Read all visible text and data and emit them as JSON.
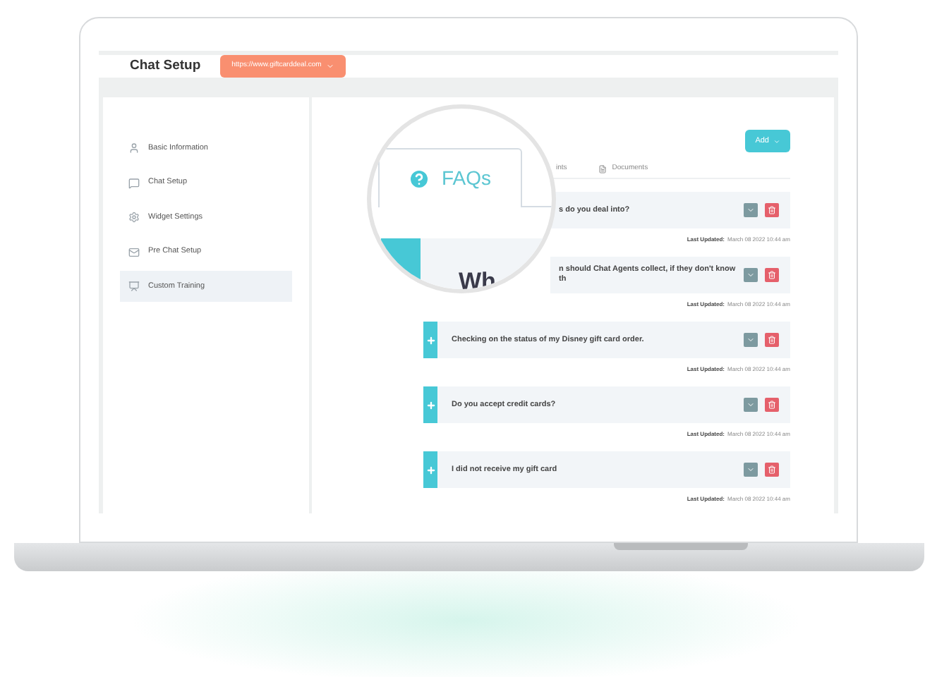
{
  "header": {
    "title": "Chat Setup",
    "site_dropdown": "https://www.giftcarddeal.com"
  },
  "sidebar": {
    "items": [
      {
        "label": "Basic Information",
        "selected": false
      },
      {
        "label": "Chat Setup",
        "selected": false
      },
      {
        "label": "Widget Settings",
        "selected": false
      },
      {
        "label": "Pre Chat Setup",
        "selected": false
      },
      {
        "label": "Custom Training",
        "selected": true
      }
    ]
  },
  "content": {
    "add_button": "Add",
    "magnifier": {
      "tab": "FAQs",
      "row_text": "Wh"
    },
    "tabs": [
      {
        "label": "ints"
      },
      {
        "label": "Documents"
      }
    ],
    "faqs": [
      {
        "kind": "covered",
        "question": "s do you deal into?",
        "updated_label": "Last Updated:",
        "updated": "March 08 2022 10:44 am"
      },
      {
        "kind": "covered",
        "question": "n should Chat Agents collect, if they don't know th",
        "updated_label": "Last Updated:",
        "updated": "March 08 2022 10:44 am"
      },
      {
        "kind": "full",
        "question": "Checking on the status of my Disney gift card order.",
        "updated_label": "Last Updated:",
        "updated": "March 08 2022 10:44 am"
      },
      {
        "kind": "full",
        "question": "Do you accept credit cards?",
        "updated_label": "Last Updated:",
        "updated": "March 08 2022 10:44 am"
      },
      {
        "kind": "full",
        "question": "I did not receive my gift card",
        "updated_label": "Last Updated:",
        "updated": "March 08 2022 10:44 am"
      }
    ]
  }
}
